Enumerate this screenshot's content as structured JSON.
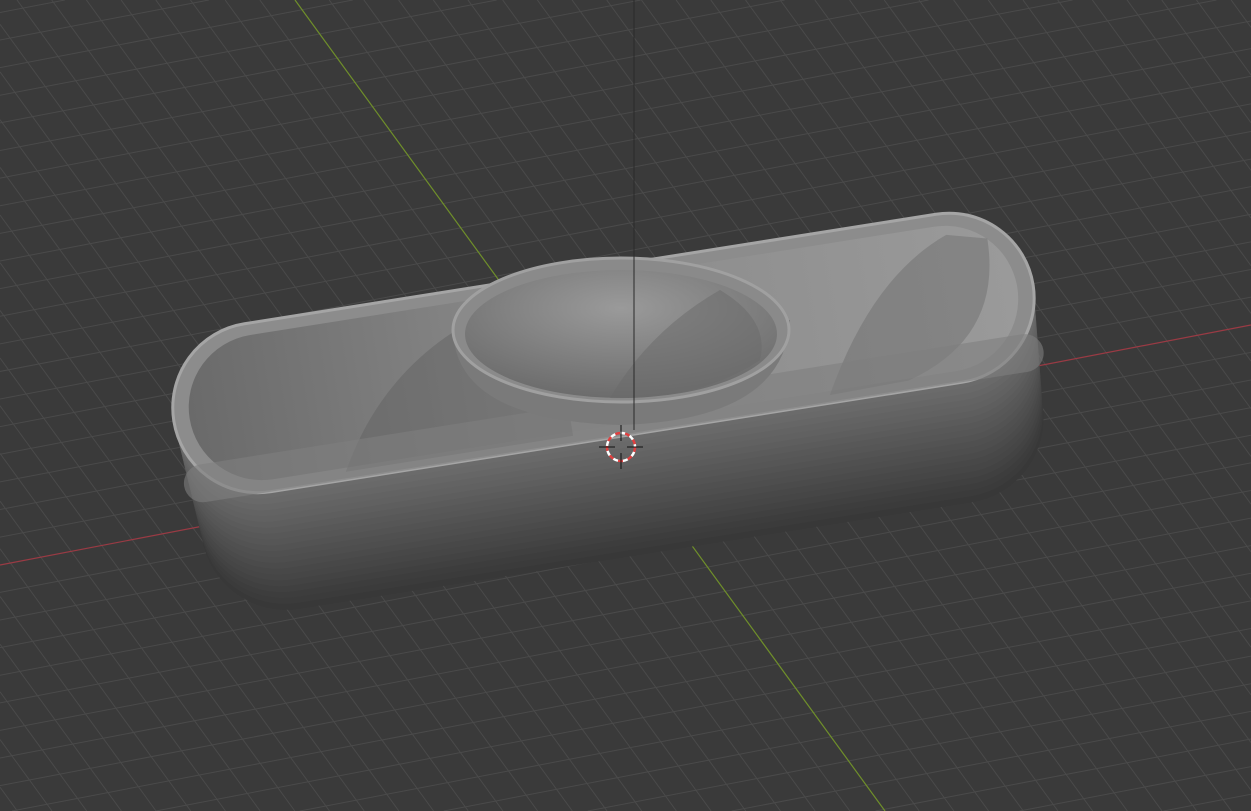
{
  "viewport": {
    "background_color": "#3a3a3a",
    "grid_color": "#4a4a4a",
    "x_axis_color": "#9a3a44",
    "y_axis_color": "#6f8f2a",
    "z_axis_color": "#2a2a2a"
  },
  "object": {
    "body_color": "#6a6a6a",
    "rim_color": "#8e8e8e",
    "inner_color": "#7c7c7c"
  },
  "cursor": {
    "icon": "3d-cursor-icon",
    "color_a": "#e04040",
    "color_b": "#ffffff"
  }
}
